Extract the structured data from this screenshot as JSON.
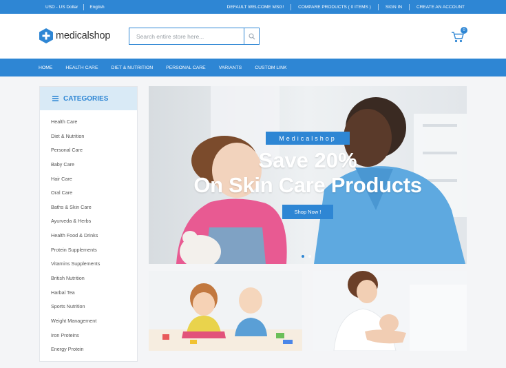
{
  "topbar": {
    "currency": "USD - US Dollar",
    "language": "English",
    "welcome": "DEFAULT WELCOME MSG!",
    "compare": "COMPARE PRODUCTS ( 0 ITEMS )",
    "signin": "SIGN IN",
    "create_account": "CREATE AN ACCOUNT"
  },
  "header": {
    "logo_text": "medicalshop",
    "search_placeholder": "Search entire store here...",
    "cart_count": "0"
  },
  "nav": {
    "items": [
      "HOME",
      "HEALTH CARE",
      "DIET & NUTRITION",
      "PERSONAL CARE",
      "VARIANTS",
      "CUSTOM LINK"
    ]
  },
  "categories": {
    "title": "CATEGORIES",
    "items": [
      "Health Care",
      "Diet & Nutrition",
      "Personal Care",
      "Baby Care",
      "Hair Care",
      "Oral Care",
      "Baths & Skin Care",
      "Ayurveda & Herbs",
      "Health Food & Drinks",
      "Protein Supplements",
      "Vitamins Supplements",
      "British Nutrition",
      "Harbal Tea",
      "Sports Nutrition",
      "Weight Management",
      "Iron Proteins",
      "Energy Protein"
    ]
  },
  "hero": {
    "tag": "Medicalshop",
    "line1": "Save 20%",
    "line2": "On Skin Care Products",
    "button": "Shop Now !",
    "active_slide": 1
  },
  "colors": {
    "accent": "#2e86d4",
    "category_header": "#d9eaf6"
  },
  "icons": {
    "search": "search-icon",
    "cart": "cart-icon",
    "menu": "hamburger-icon",
    "logo": "medical-cross-icon"
  }
}
